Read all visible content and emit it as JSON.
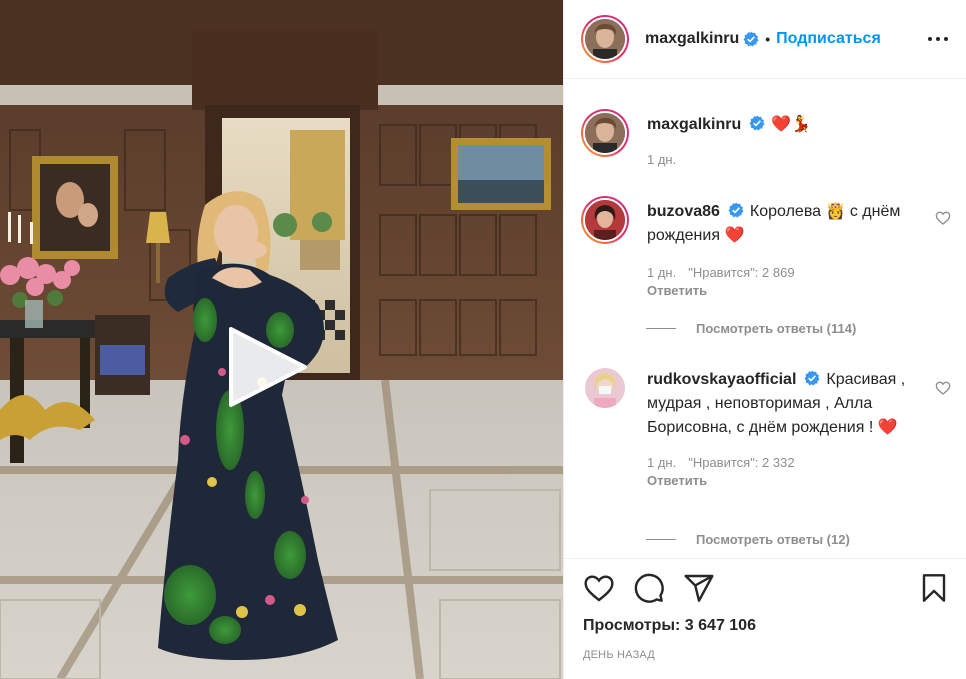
{
  "post": {
    "author": "maxgalkinru",
    "follow_label": "Подписаться",
    "separator": "•"
  },
  "caption": {
    "username": "maxgalkinru",
    "emoji": "❤️💃",
    "time": "1 дн."
  },
  "comments": [
    {
      "username": "buzova86",
      "text": "Королева 👸 с днём рождения ❤️",
      "time": "1 дн.",
      "likes": "\"Нравится\": 2 869",
      "reply_label": "Ответить",
      "view_replies": "Посмотреть ответы (114)"
    },
    {
      "username": "rudkovskayaofficial",
      "text": "Красивая , мудрая , неповторимая , Алла Борисовна, с днём рождения ! ❤️",
      "time": "1 дн.",
      "likes": "\"Нравится\": 2 332",
      "reply_label": "Ответить",
      "view_replies": "Посмотреть ответы (12)"
    }
  ],
  "footer": {
    "views_label": "Просмотры:",
    "views_value": "3 647 106",
    "date": "ДЕНЬ НАЗАД"
  },
  "icons": {
    "verified": "verified-badge-icon",
    "more": "more-options-icon",
    "like": "heart-icon",
    "comment": "comment-icon",
    "share": "share-icon",
    "save": "bookmark-icon",
    "play": "play-icon"
  },
  "colors": {
    "accent": "#0095f6",
    "verified": "#3897f0",
    "heart": "#ed4956",
    "muted": "#8e8e8e"
  }
}
